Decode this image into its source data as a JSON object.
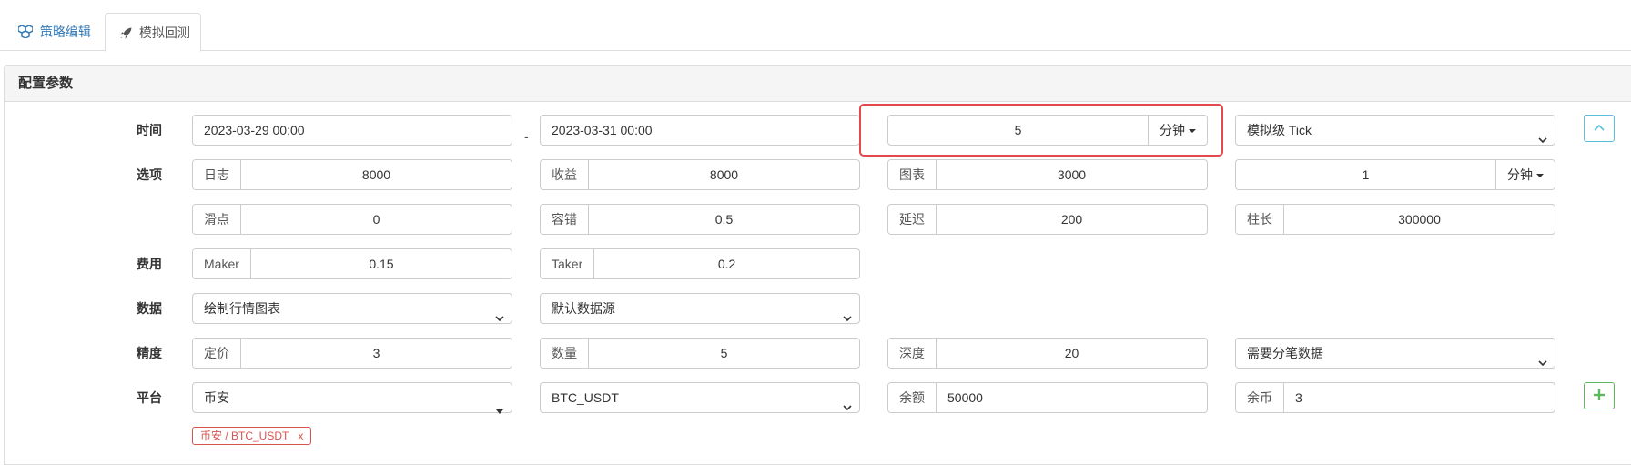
{
  "tabs": [
    {
      "label": "策略编辑",
      "icon": "cubes-icon",
      "active": false
    },
    {
      "label": "模拟回测",
      "icon": "rocket-icon",
      "active": true
    }
  ],
  "panel": {
    "title": "配置参数"
  },
  "rows": {
    "time": {
      "label": "时间",
      "start": "2023-03-29 00:00",
      "separator": "-",
      "end": "2023-03-31 00:00",
      "period_value": "5",
      "period_unit": "分钟",
      "mode": "模拟级 Tick"
    },
    "options": {
      "label": "选项",
      "log_label": "日志",
      "log_value": "8000",
      "profit_label": "收益",
      "profit_value": "8000",
      "chart_label": "图表",
      "chart_value": "3000",
      "interval_value": "1",
      "interval_unit": "分钟",
      "slippage_label": "滑点",
      "slippage_value": "0",
      "tolerance_label": "容错",
      "tolerance_value": "0.5",
      "delay_label": "延迟",
      "delay_value": "200",
      "bar_label": "柱长",
      "bar_value": "300000"
    },
    "fees": {
      "label": "费用",
      "maker_label": "Maker",
      "maker_value": "0.15",
      "taker_label": "Taker",
      "taker_value": "0.2"
    },
    "data": {
      "label": "数据",
      "chart_select": "绘制行情图表",
      "source_select": "默认数据源"
    },
    "precision": {
      "label": "精度",
      "price_label": "定价",
      "price_value": "3",
      "qty_label": "数量",
      "qty_value": "5",
      "depth_label": "深度",
      "depth_value": "20",
      "tick_select": "需要分笔数据"
    },
    "platform": {
      "label": "平台",
      "exchange": "币安",
      "pair": "BTC_USDT",
      "balance_label": "余额",
      "balance_value": "50000",
      "coins_label": "余币",
      "coins_value": "3",
      "tag_text": "币安 / BTC_USDT",
      "tag_remove": "x"
    }
  },
  "colors": {
    "link": "#337ab7",
    "highlight": "#e5484d",
    "collapse_btn": "#5bc0de",
    "add_btn": "#5cb85c",
    "tag": "#d9534f"
  }
}
